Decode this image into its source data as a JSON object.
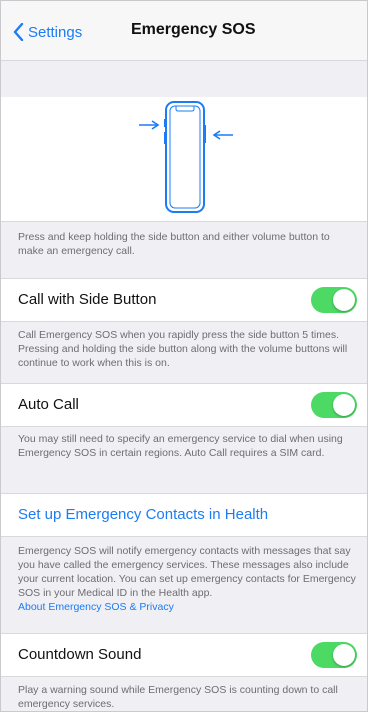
{
  "nav": {
    "back_label": "Settings",
    "title": "Emergency SOS"
  },
  "illustration": {
    "icon": "phone-side-button-icon",
    "accent": "#1c7cf4"
  },
  "intro_note": "Press and keep holding the side button and either volume button to make an emergency call.",
  "call_side_button": {
    "label": "Call with Side Button",
    "on": true,
    "note": "Call Emergency SOS when you rapidly press the side button 5 times. Pressing and holding the side button along with the volume buttons will continue to work when this is on."
  },
  "auto_call": {
    "label": "Auto Call",
    "on": true,
    "note": "You may still need to specify an emergency service to dial when using Emergency SOS in certain regions. Auto Call requires a SIM card."
  },
  "emergency_contacts": {
    "label": "Set up Emergency Contacts in Health",
    "note": "Emergency SOS will notify emergency contacts with messages that say you have called the emergency services. These messages also include your current location. You can set up emergency contacts for Emergency SOS in your Medical ID in the Health app.",
    "privacy_link": "About Emergency SOS & Privacy"
  },
  "countdown_sound": {
    "label": "Countdown Sound",
    "on": true,
    "note": "Play a warning sound while Emergency SOS is counting down to call emergency services."
  },
  "colors": {
    "toggle_on": "#4cd964",
    "link": "#1c7cf4",
    "background": "#efeff4"
  }
}
